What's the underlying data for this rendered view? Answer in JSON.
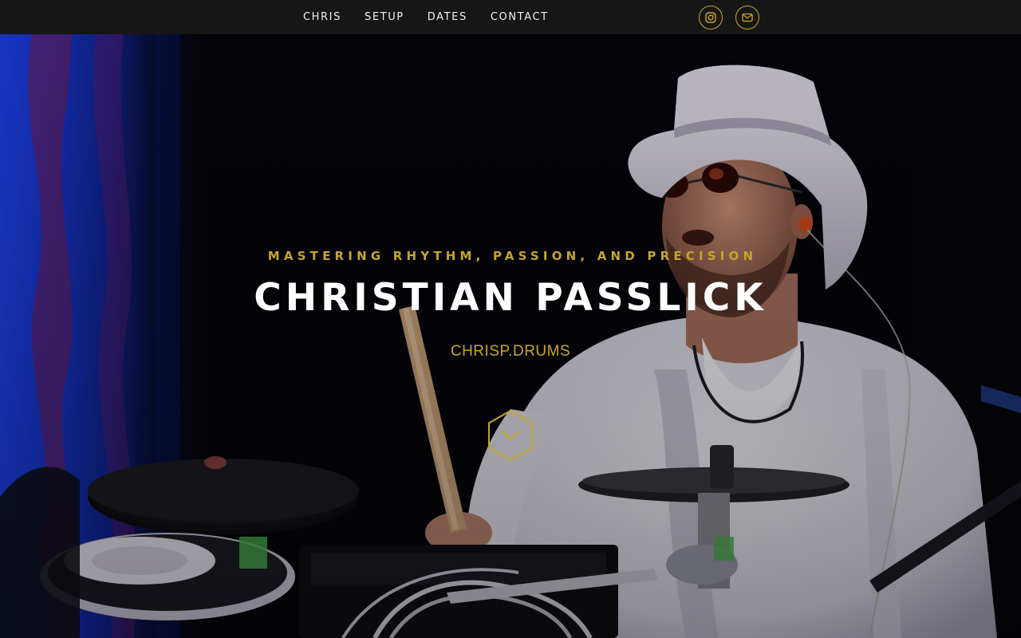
{
  "nav": {
    "items": [
      {
        "label": "CHRIS"
      },
      {
        "label": "SETUP"
      },
      {
        "label": "DATES"
      },
      {
        "label": "CONTACT"
      }
    ],
    "social": [
      {
        "icon": "instagram-icon"
      },
      {
        "icon": "mail-icon"
      }
    ]
  },
  "hero": {
    "tagline": "MASTERING RHYTHM, PASSION, AND PRECISION",
    "name": "CHRISTIAN PASSLICK",
    "handle": "CHRISP.DRUMS",
    "scroll_icon": "chevron-down-hexagon-icon"
  },
  "colors": {
    "accent": "#c6a62a",
    "nav_bg": "#161616",
    "text": "#ffffff"
  }
}
